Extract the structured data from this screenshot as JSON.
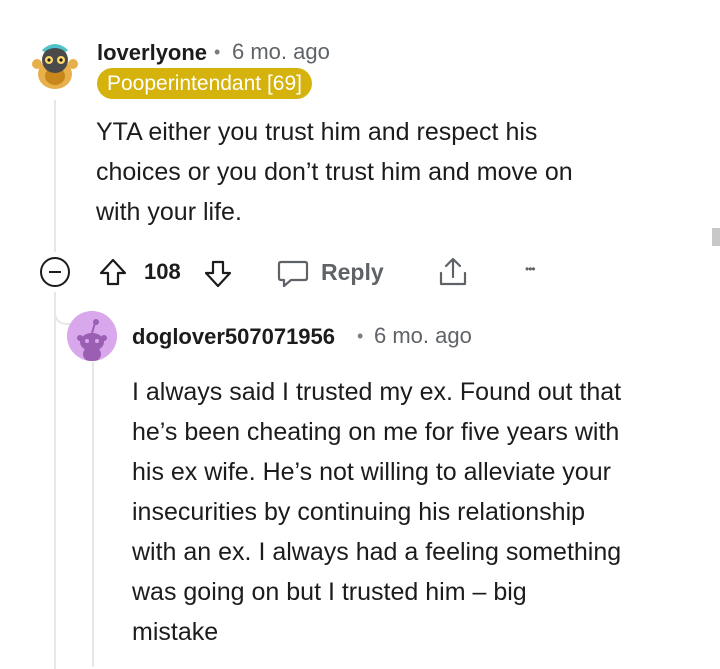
{
  "comment": {
    "username": "loverlyone",
    "separator": "•",
    "timestamp": "6 mo. ago",
    "flair": "Pooperintendant [69]",
    "body_lines": [
      "YTA either you trust him and respect his",
      "choices or you don’t trust him and move on",
      "with your life."
    ],
    "vote_count": "108",
    "reply_label": "Reply",
    "more_label": "•••"
  },
  "reply": {
    "username": "doglover507071956",
    "separator": "•",
    "timestamp": "6 mo. ago",
    "body_lines": [
      "I always said I trusted my ex. Found out that",
      "he’s been cheating on me for five years with",
      "his ex wife. He’s not willing to alleviate your",
      "insecurities by continuing his relationship",
      "with an ex. I always had a feeling something",
      "was going on but I trusted him – big",
      "mistake"
    ]
  },
  "colors": {
    "flair_bg": "#d5b30c",
    "avatar_reply_bg": "#d9a8ec",
    "thread_line": "#e5e7e8",
    "meta_text": "#5f6368"
  }
}
